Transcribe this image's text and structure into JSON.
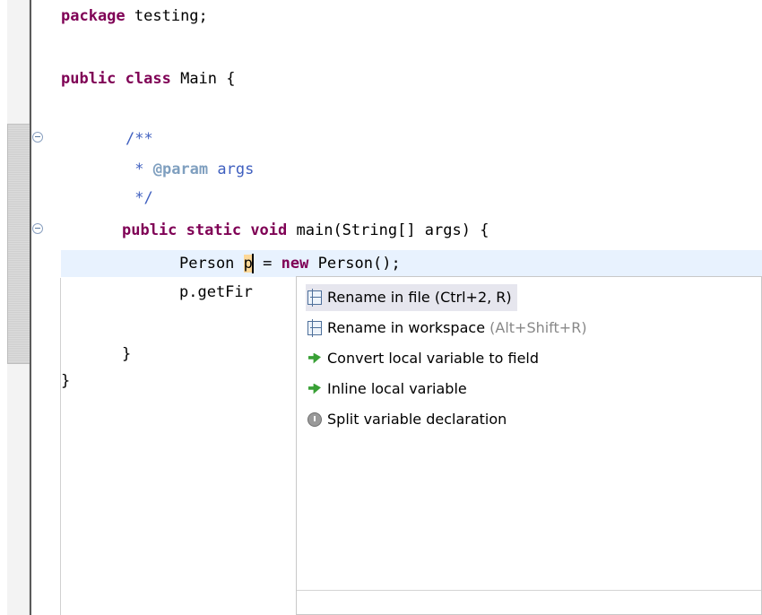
{
  "editor": {
    "lines": {
      "package_kw": "package",
      "package_name": " testing;",
      "class_kw1": "public",
      "class_kw2": " class",
      "class_name": " Main {",
      "doc_open": "/**",
      "doc_tag": "@param",
      "doc_star": " * ",
      "doc_text": " args",
      "doc_close": " */",
      "main_kw1": "public",
      "main_kw2": " static",
      "main_kw3": " void",
      "main_rest": " main(String[] args) {",
      "decl_type": "Person ",
      "decl_var": "p",
      "decl_eq": " = ",
      "decl_new": "new",
      "decl_rest": " Person();",
      "call_text": "p.getFir",
      "close_method": "}",
      "close_class": "}"
    }
  },
  "popup": {
    "items": [
      {
        "label": "Rename in file (Ctrl+2, R)",
        "hint": "",
        "icon": "rename-icon"
      },
      {
        "label": "Rename in workspace ",
        "hint": "(Alt+Shift+R)",
        "icon": "rename-icon"
      },
      {
        "label": "Convert local variable to field",
        "hint": "",
        "icon": "green-arrow-icon"
      },
      {
        "label": "Inline local variable",
        "hint": "",
        "icon": "green-arrow-icon"
      },
      {
        "label": "Split variable declaration",
        "hint": "",
        "icon": "gray-bullet-icon"
      }
    ]
  },
  "colors": {
    "keyword": "#7f0055",
    "javadoc": "#3f5fbf",
    "javadoc_tag": "#7f9fbf",
    "current_line": "#e8f2fe",
    "occurrence": "#fdd898"
  }
}
